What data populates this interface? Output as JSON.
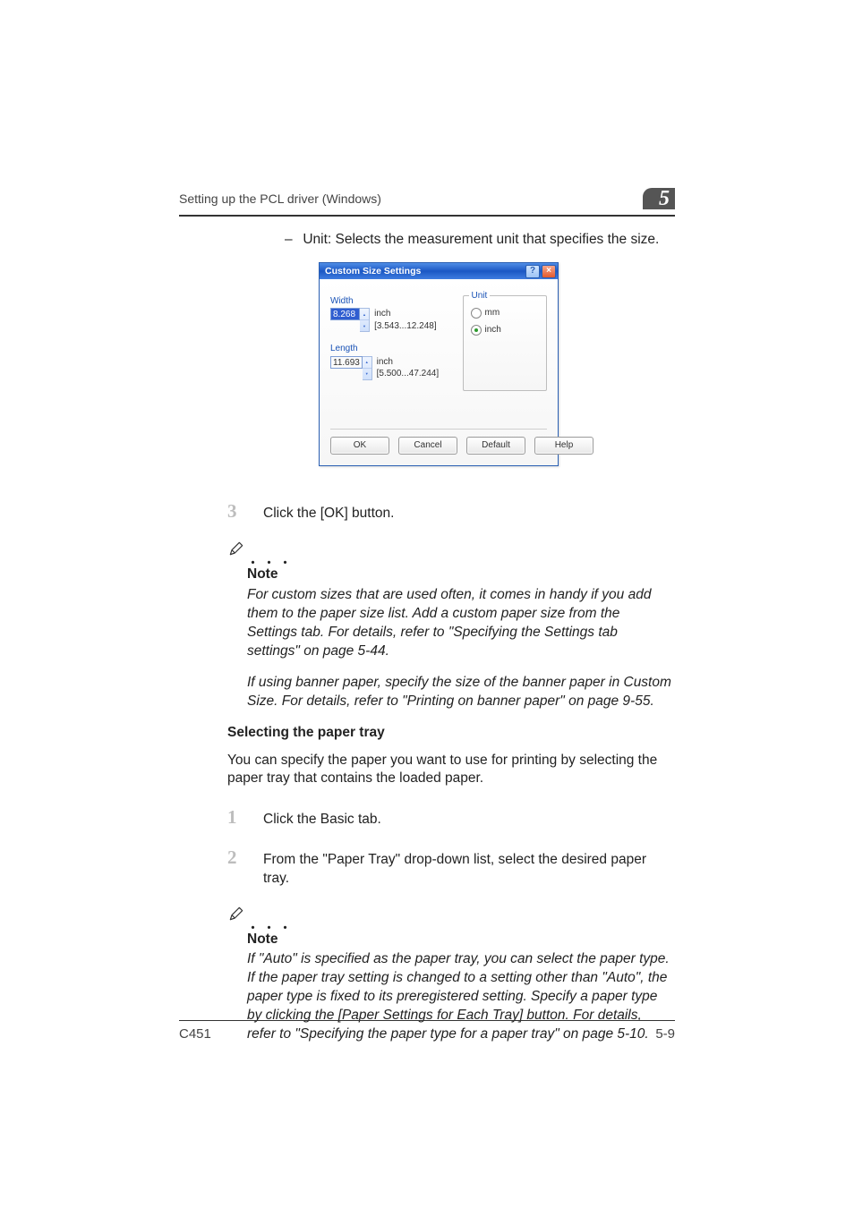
{
  "header": {
    "title": "Setting up the PCL driver (Windows)",
    "chapter_number": "5"
  },
  "bullet_prefix": "–",
  "unit_bullet_text": "Unit: Selects the measurement unit that specifies the size.",
  "dialog": {
    "title": "Custom Size Settings",
    "width_label": "Width",
    "width_value": "8.268",
    "width_range": "inch [3.543...12.248]",
    "length_label": "Length",
    "length_value": "11.693",
    "length_range": "inch [5.500...47.244]",
    "unit_legend": "Unit",
    "unit_mm": "mm",
    "unit_inch": "inch",
    "btn_ok": "OK",
    "btn_cancel": "Cancel",
    "btn_default": "Default",
    "btn_help": "Help",
    "help_glyph": "?",
    "close_glyph": "×"
  },
  "steps_a": {
    "n3": "3",
    "t3": "Click the [OK] button."
  },
  "note_label": "Note",
  "note_dots": ". . .",
  "note1_p1": "For custom sizes that are used often, it comes in handy if you add them to the paper size list. Add a custom paper size from the Settings tab. For details, refer to \"Specifying the Settings tab settings\" on page 5-44.",
  "note1_p2": "If using banner paper, specify the size of the banner paper in Custom Size. For details, refer to \"Printing on banner paper\" on page 9-55.",
  "section_heading": "Selecting the paper tray",
  "section_intro": "You can specify the paper you want to use for printing by selecting the paper tray that contains the loaded paper.",
  "steps_b": {
    "n1": "1",
    "t1": "Click the Basic tab.",
    "n2": "2",
    "t2": "From the \"Paper Tray\" drop-down list, select the desired paper tray."
  },
  "note2_p1": "If \"Auto\" is specified as the paper tray, you can select the paper type. If the paper tray setting is changed to a setting other than \"Auto\", the paper type is fixed to its preregistered setting. Specify a paper type by clicking the [Paper Settings for Each Tray] button. For details, refer to \"Specifying the paper type for a paper tray\" on page 5-10.",
  "footer": {
    "left": "C451",
    "right": "5-9"
  }
}
